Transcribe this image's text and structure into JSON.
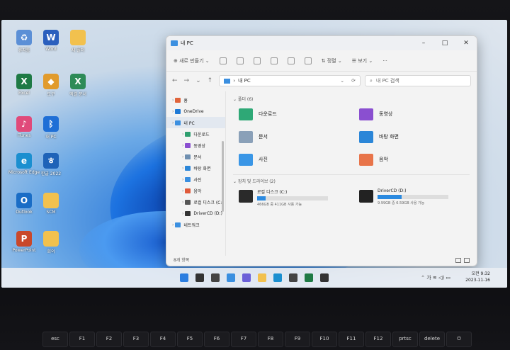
{
  "desktop": {
    "icons": [
      {
        "label": "휴지통",
        "icon": "recycle-bin-icon",
        "color": "#5b8fd6",
        "glyph": "♻"
      },
      {
        "label": "Word",
        "icon": "word-icon",
        "color": "#2b5fbd",
        "glyph": "W"
      },
      {
        "label": "새 폴더",
        "icon": "folder-icon",
        "color": "#f2c14e",
        "glyph": ""
      },
      {
        "label": "Excel",
        "icon": "excel-icon",
        "color": "#1f7a45",
        "glyph": "X"
      },
      {
        "label": "도구",
        "icon": "control-panel-icon",
        "color": "#e19b2c",
        "glyph": "◆"
      },
      {
        "label": "엑셀 문서",
        "icon": "excel-doc-icon",
        "color": "#2e8b57",
        "glyph": "X"
      },
      {
        "label": "iTunes",
        "icon": "itunes-icon",
        "color": "#e04a7a",
        "glyph": "♪"
      },
      {
        "label": "내 PC",
        "icon": "bluetooth-icon",
        "color": "#1f6fd6",
        "glyph": "ᛒ"
      },
      {
        "label": "Microsoft Edge",
        "icon": "edge-icon",
        "color": "#1b8fd0",
        "glyph": "e"
      },
      {
        "label": "한글 2022",
        "icon": "hangul-icon",
        "color": "#1f63b8",
        "glyph": "ㅎ"
      },
      {
        "label": "Outlook",
        "icon": "outlook-icon",
        "color": "#1a6dc6",
        "glyph": "O"
      },
      {
        "label": "SCM",
        "icon": "folder-icon",
        "color": "#f2c14e",
        "glyph": ""
      },
      {
        "label": "PowerPoint",
        "icon": "powerpoint-icon",
        "color": "#c9482b",
        "glyph": "P"
      },
      {
        "label": "회의",
        "icon": "folder-icon",
        "color": "#f2c14e",
        "glyph": ""
      }
    ]
  },
  "window": {
    "title": "내 PC",
    "toolbar": {
      "new_label": "새로 만들기",
      "sort_label": "정렬",
      "view_label": "보기",
      "more_label": "···"
    },
    "address": {
      "path": "내 PC",
      "search_placeholder": "내 PC 검색"
    },
    "nav": [
      {
        "label": "홈",
        "color": "#e0643b",
        "sub": false,
        "selected": false
      },
      {
        "label": "OneDrive",
        "color": "#1f7ad6",
        "sub": false,
        "selected": false
      },
      {
        "label": "내 PC",
        "color": "#3b8fe0",
        "sub": false,
        "selected": true
      },
      {
        "label": "다운로드",
        "color": "#2e9e6e",
        "sub": true,
        "selected": false
      },
      {
        "label": "동영상",
        "color": "#8a4fd0",
        "sub": true,
        "selected": false
      },
      {
        "label": "문서",
        "color": "#6f8fb0",
        "sub": true,
        "selected": false
      },
      {
        "label": "바탕 화면",
        "color": "#2b86d8",
        "sub": true,
        "selected": false
      },
      {
        "label": "사진",
        "color": "#3a8fe0",
        "sub": true,
        "selected": false
      },
      {
        "label": "음악",
        "color": "#e05a3a",
        "sub": true,
        "selected": false
      },
      {
        "label": "로컬 디스크 (C:)",
        "color": "#555555",
        "sub": true,
        "selected": false
      },
      {
        "label": "DriverCD (D:)",
        "color": "#333333",
        "sub": true,
        "selected": false
      },
      {
        "label": "네트워크",
        "color": "#3a8fe0",
        "sub": false,
        "selected": false
      }
    ],
    "folders_header": "폴더 (6)",
    "folders": [
      {
        "label": "다운로드",
        "color": "#2ea876",
        "icon": "downloads-folder-icon"
      },
      {
        "label": "동영상",
        "color": "#8a4fd0",
        "icon": "videos-folder-icon"
      },
      {
        "label": "문서",
        "color": "#8aa0b8",
        "icon": "documents-folder-icon"
      },
      {
        "label": "바탕 화면",
        "color": "#2b86d8",
        "icon": "desktop-folder-icon"
      },
      {
        "label": "사진",
        "color": "#3a96e6",
        "icon": "pictures-folder-icon"
      },
      {
        "label": "음악",
        "color": "#e8744a",
        "icon": "music-folder-icon"
      }
    ],
    "drives_header": "장치 및 드라이브 (2)",
    "drives": [
      {
        "label": "로컬 디스크 (C:)",
        "free": "466GB 중 411GB 사용 가능",
        "used_fraction": 0.12,
        "color": "#2a2a2a",
        "icon": "local-disk-icon"
      },
      {
        "label": "DriverCD (D:)",
        "free": "9.99GB 중 6.59GB 사용 가능",
        "used_fraction": 0.34,
        "color": "#222222",
        "icon": "driver-cd-icon"
      }
    ],
    "status": "8개 항목"
  },
  "taskbar": {
    "apps": [
      {
        "icon": "start-icon",
        "color": "#2b7de0"
      },
      {
        "icon": "search-icon",
        "color": "#333333"
      },
      {
        "icon": "task-view-icon",
        "color": "#444444"
      },
      {
        "icon": "widgets-icon",
        "color": "#3a8fe0"
      },
      {
        "icon": "chat-icon",
        "color": "#6a5fd8"
      },
      {
        "icon": "file-explorer-icon",
        "color": "#f2c14e"
      },
      {
        "icon": "edge-icon",
        "color": "#1b8fd0"
      },
      {
        "icon": "store-icon",
        "color": "#444444"
      },
      {
        "icon": "excel-icon",
        "color": "#1f7a45"
      },
      {
        "icon": "app-icon",
        "color": "#333333"
      }
    ],
    "time": "오전 9:32",
    "date": "2023-11-16"
  },
  "keyboard": {
    "keys": [
      "esc",
      "F1",
      "F2",
      "F3",
      "F4",
      "F5",
      "F6",
      "F7",
      "F8",
      "F9",
      "F10",
      "F11",
      "F12",
      "prtsc",
      "delete",
      "⏻"
    ]
  }
}
